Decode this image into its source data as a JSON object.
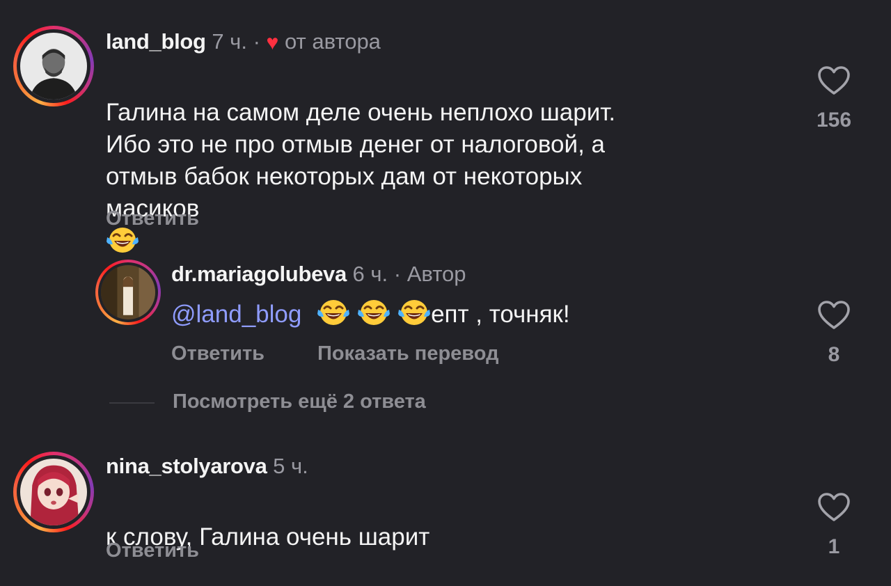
{
  "comments": [
    {
      "username": "land_blog",
      "time": "7 ч.",
      "separator": "·",
      "author_badge": "от автора",
      "text": "Галина на самом деле очень неплохо шарит.\nИбо это не про отмыв денег от налоговой, а\nотмыв бабок некоторых дам от некоторых\nмасиков",
      "reply_label": "Ответить",
      "like_count": "156"
    },
    {
      "username": "dr.mariagolubeva",
      "time": "6 ч.",
      "separator": "·",
      "author_badge": "Автор",
      "mention": "@land_blog",
      "text": "епт , точняк!",
      "reply_label": "Ответить",
      "translate_label": "Показать перевод",
      "like_count": "8"
    },
    {
      "username": "nina_stolyarova",
      "time": "5 ч.",
      "text": "к слову, Галина очень шарит",
      "reply_label": "Ответить",
      "like_count": "1"
    }
  ],
  "view_more_replies": "Посмотреть ещё 2 ответа",
  "icons": {
    "like": "heart-outline-icon",
    "liked_by_author": "heart-filled-icon",
    "emoji": "face-with-tears-of-joy-emoji"
  },
  "colors": {
    "background": "#222227",
    "mention": "#8f9cff",
    "heart": "#ff3040"
  }
}
